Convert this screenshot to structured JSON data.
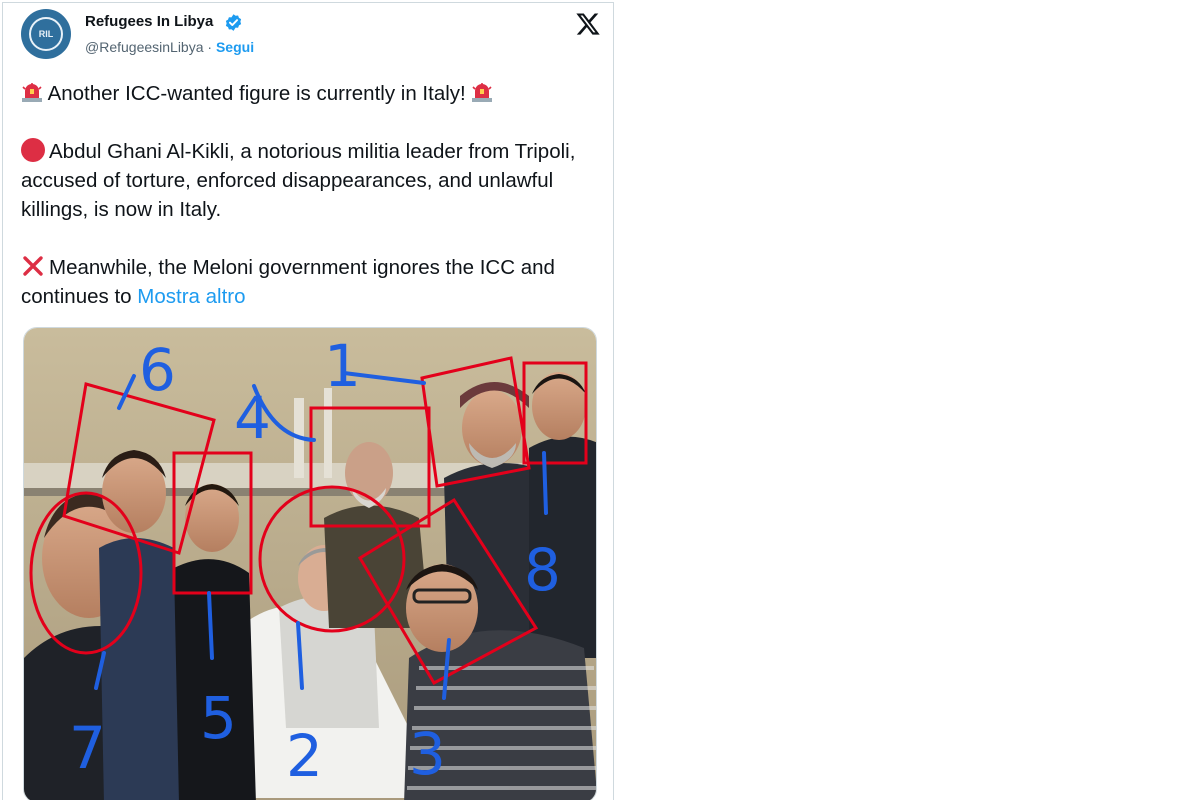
{
  "account": {
    "display_name": "Refugees In Libya",
    "handle": "@RefugeesinLibya",
    "separator": " · ",
    "follow_label": "Segui",
    "avatar_text": "RIL"
  },
  "icons": {
    "logo": "x-logo-icon",
    "verified": "verified-badge-icon",
    "siren": "police-light-emoji-icon",
    "red_circle": "red-circle-emoji-icon",
    "cross": "cross-mark-emoji-icon"
  },
  "tweet": {
    "line1": "Another ICC-wanted figure is currently in Italy!",
    "para2": "Abdul Ghani Al-Kikli, a notorious militia leader from Tripoli, accused of torture, enforced disappearances, and unlawful killings, is now in Italy.",
    "para3": "Meanwhile, the Meloni government ignores the ICC and continues to",
    "show_more": "Mostra altro"
  },
  "annotations": [
    "1",
    "2",
    "3",
    "4",
    "5",
    "6",
    "7",
    "8"
  ],
  "colors": {
    "link": "#1d9bf0",
    "annotation_red": "#e3001b",
    "annotation_blue": "#1f5fe0",
    "text": "#0f1419",
    "muted": "#536471"
  }
}
